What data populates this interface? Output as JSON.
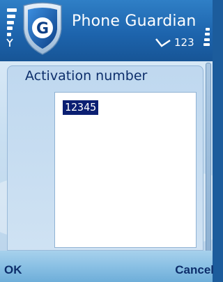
{
  "status_pane": {
    "app_title": "Phone Guardian",
    "app_icon_letter": "G",
    "message_indicator": "123",
    "icons": {
      "signal": "signal-strength-icon",
      "antenna": "antenna-icon",
      "app": "shield-g-icon",
      "messages": "message-envelope-icon",
      "battery": "battery-icon"
    }
  },
  "dialog": {
    "heading": "Activation number",
    "input_value": "12345"
  },
  "softkeys": {
    "left": "OK",
    "right": "Cancel"
  },
  "colors": {
    "status_bg": "#1d64ad",
    "heading_text": "#0d2e6b",
    "selection_bg": "#0b1f72"
  }
}
